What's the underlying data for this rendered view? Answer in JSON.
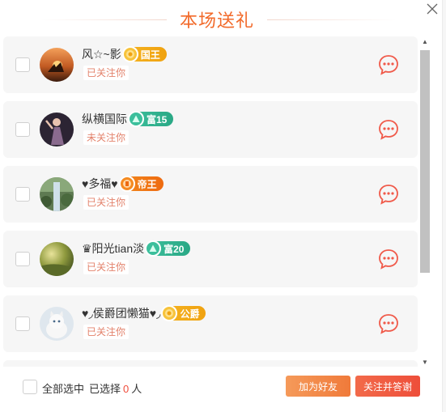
{
  "title": "本场送礼",
  "users": [
    {
      "name": "风☆~影",
      "badge": {
        "label": "国王",
        "kind": "king",
        "icon": "crown-coin-icon"
      },
      "follow": "已关注你",
      "avatar_theme": "sunset"
    },
    {
      "name": "纵横国际",
      "badge": {
        "label": "富15",
        "kind": "rich",
        "icon": "rich-triangle-icon"
      },
      "follow": "未关注你",
      "avatar_theme": "dancer"
    },
    {
      "name": "♥多福♥",
      "badge": {
        "label": "帝王",
        "kind": "emperor",
        "icon": "emperor-coin-icon"
      },
      "follow": "已关注你",
      "avatar_theme": "waterfall"
    },
    {
      "name": "♛阳光tian淡",
      "badge": {
        "label": "富20",
        "kind": "rich",
        "icon": "rich-triangle-icon"
      },
      "follow": "已关注你",
      "avatar_theme": "forest"
    },
    {
      "name": "♥◞侯爵团懒猫♥◞",
      "badge": {
        "label": "公爵",
        "kind": "duke",
        "icon": "duke-coin-icon"
      },
      "follow": "已关注你",
      "avatar_theme": "kitten"
    }
  ],
  "footer": {
    "select_all": "全部选中",
    "selected_prefix": "已选择",
    "selected_count": "0",
    "selected_suffix": "人",
    "add_friend": "加为好友",
    "follow_thank": "关注并答谢"
  },
  "colors": {
    "accent": "#f26a2a",
    "follow_text": "#e3826b",
    "chat_icon": "#f05a4a"
  }
}
